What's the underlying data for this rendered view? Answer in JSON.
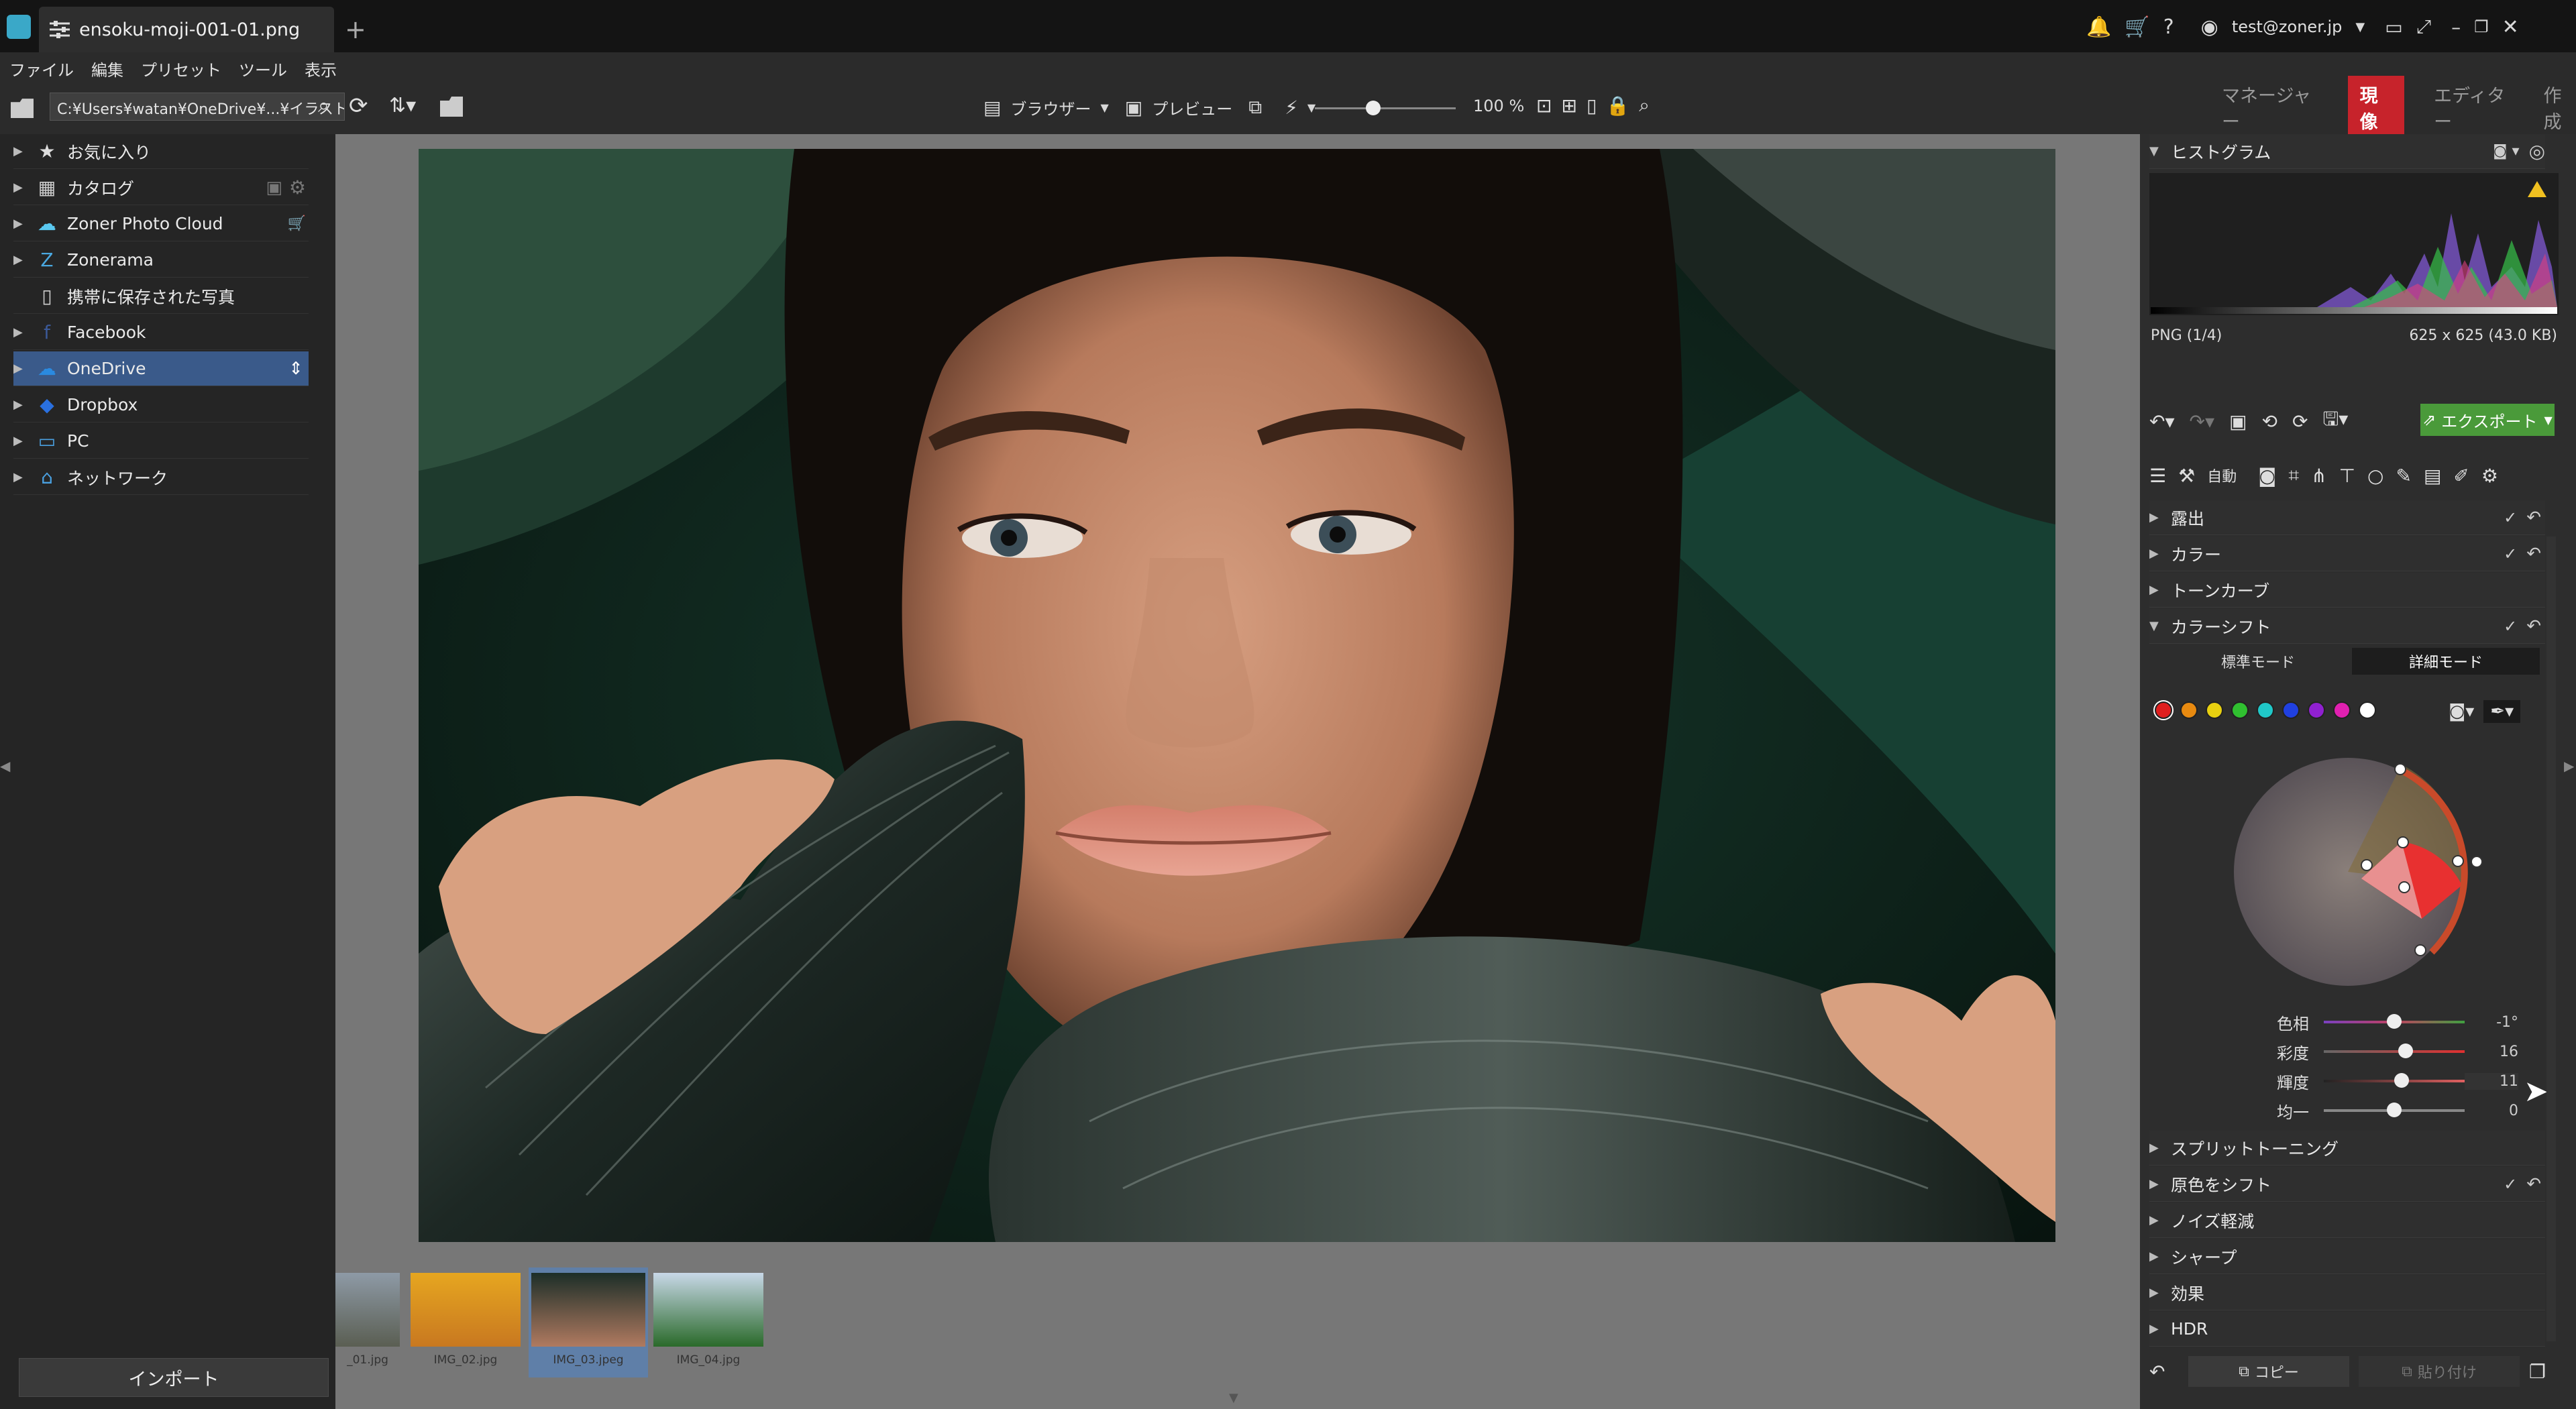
{
  "window": {
    "tab_title": "ensoku-moji-001-01.png",
    "user": "test@zoner.jp"
  },
  "menu": [
    "ファイル",
    "編集",
    "プリセット",
    "ツール",
    "表示"
  ],
  "toolbar": {
    "path": "C:¥Users¥watan¥OneDrive¥...¥イラスト",
    "browser_label": "ブラウザー",
    "preview_label": "プレビュー",
    "zoom": "100 %",
    "modes": [
      "マネージャー",
      "現像",
      "エディター",
      "作成"
    ]
  },
  "sidebar": {
    "items": [
      {
        "label": "お気に入り",
        "icon": "star-icon"
      },
      {
        "label": "カタログ",
        "icon": "catalog-icon"
      },
      {
        "label": "Zoner Photo Cloud",
        "icon": "cloud-icon"
      },
      {
        "label": "Zonerama",
        "icon": "zonerama-icon"
      },
      {
        "label": "携帯に保存された写真",
        "icon": "phone-icon"
      },
      {
        "label": "Facebook",
        "icon": "facebook-icon"
      },
      {
        "label": "OneDrive",
        "icon": "onedrive-icon"
      },
      {
        "label": "Dropbox",
        "icon": "dropbox-icon"
      },
      {
        "label": "PC",
        "icon": "pc-icon"
      },
      {
        "label": "ネットワーク",
        "icon": "network-icon"
      }
    ],
    "import_label": "インポート"
  },
  "filmstrip": [
    {
      "name": "_01.jpg"
    },
    {
      "name": "IMG_02.jpg"
    },
    {
      "name": "IMG_03.jpeg"
    },
    {
      "name": "IMG_04.jpg"
    }
  ],
  "panel": {
    "histogram_title": "ヒストグラム",
    "file_format": "PNG  (1/4)",
    "file_info": "625 x 625 (43.0 KB)",
    "export_label": "エクスポート",
    "auto_label": "自動",
    "sections_top": [
      "露出",
      "カラー",
      "トーンカーブ",
      "カラーシフト"
    ],
    "mode_standard": "標準モード",
    "mode_detail": "詳細モード",
    "swatch_colors": [
      "#e01e1e",
      "#e88a10",
      "#e8d010",
      "#30c030",
      "#20c8c8",
      "#2040e0",
      "#9020d0",
      "#e020b0",
      "#ffffff"
    ],
    "sliders": [
      {
        "label": "色相",
        "value": "-1°",
        "level": 0.5
      },
      {
        "label": "彩度",
        "value": "16",
        "level": 0.58
      },
      {
        "label": "輝度",
        "value": "11",
        "level": 0.55
      },
      {
        "label": "均一",
        "value": "0",
        "level": 0.5
      }
    ],
    "sections_bottom": [
      "スプリットトーニング",
      "原色をシフト",
      "ノイズ軽減",
      "シャープ",
      "効果",
      "HDR"
    ],
    "copy_label": "コピー",
    "paste_label": "貼り付け"
  }
}
